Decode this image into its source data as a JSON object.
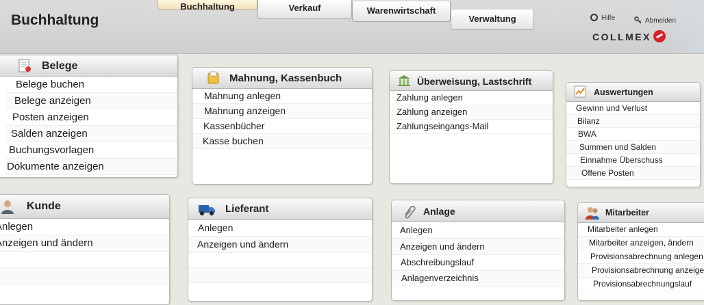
{
  "header": {
    "title": "Buchhaltung",
    "tabs": [
      {
        "label": "Buchhaltung",
        "active": true
      },
      {
        "label": "Verkauf",
        "active": false
      },
      {
        "label": "Warenwirtschaft",
        "active": false
      },
      {
        "label": "Verwaltung",
        "active": false
      }
    ],
    "help_label": "Hilfe",
    "logout_label": "Abmelden",
    "logo_text": "COLLMEX"
  },
  "panels": {
    "belege": {
      "title": "Belege",
      "icon": "document-certificate-icon",
      "items": [
        "Belege buchen",
        "Belege anzeigen",
        "Posten anzeigen",
        "Salden anzeigen",
        "Buchungsvorlagen",
        "Dokumente anzeigen"
      ]
    },
    "mahnung": {
      "title": "Mahnung, Kassenbuch",
      "icon": "folder-icon",
      "items": [
        "Mahnung anlegen",
        "Mahnung anzeigen",
        "Kassenbücher",
        "Kasse buchen"
      ]
    },
    "ueberweisung": {
      "title": "Überweisung, Lastschrift",
      "icon": "bank-transfer-icon",
      "items": [
        "Zahlung anlegen",
        "Zahlung anzeigen",
        "Zahlungseingangs-Mail"
      ]
    },
    "auswertungen": {
      "title": "Auswertungen",
      "icon": "chart-icon",
      "items": [
        "Gewinn und Verlust",
        "Bilanz",
        "BWA",
        "Summen und Salden",
        "Einnahme Überschuss",
        "Offene Posten"
      ]
    },
    "kunde": {
      "title": "Kunde",
      "icon": "customer-person-icon",
      "items": [
        "Anlegen",
        "Anzeigen und ändern"
      ]
    },
    "lieferant": {
      "title": "Lieferant",
      "icon": "delivery-truck-icon",
      "items": [
        "Anlegen",
        "Anzeigen und ändern"
      ]
    },
    "anlage": {
      "title": "Anlage",
      "icon": "paperclip-icon",
      "items": [
        "Anlegen",
        "Anzeigen und ändern",
        "Abschreibungslauf",
        "Anlagenverzeichnis"
      ]
    },
    "mitarbeiter": {
      "title": "Mitarbeiter",
      "icon": "employees-icon",
      "items": [
        "Mitarbeiter anlegen",
        "Mitarbeiter anzeigen, ändern",
        "Provisionsabrechnung anlegen",
        "Provisionsabrechnung anzeigen",
        "Provisionsabrechnungslauf"
      ]
    }
  },
  "colors": {
    "header_bg": "#d3d3d3",
    "page_bg": "#e9e7e2",
    "active_tab": "#f3e3bc",
    "logo_red": "#d6202a"
  }
}
